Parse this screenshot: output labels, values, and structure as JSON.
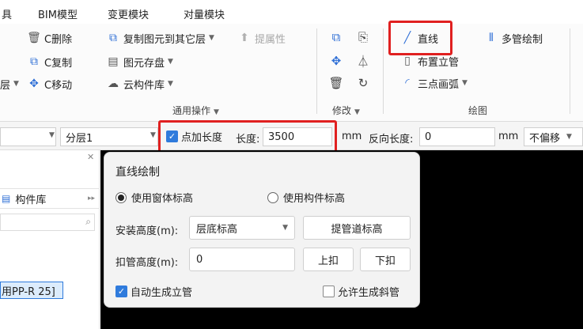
{
  "menu_tabs": [
    "具",
    "BIM模型",
    "变更模块",
    "对量模块"
  ],
  "ribbon": {
    "col1": {
      "delete": "C删除",
      "copy": "C复制",
      "layer_partial": "层",
      "move": "C移动"
    },
    "col2": {
      "copy_to_layer": "复制图元到其它层",
      "raise_attr": "提属性",
      "element_save": "图元存盘",
      "cloud_lib": "云构件库"
    },
    "group_general": "通用操作",
    "group_modify": "修改",
    "group_draw": "绘图",
    "draw": {
      "line": "直线",
      "multi_pipe": "多管绘制",
      "vertical_pipe": "布置立管",
      "three_point_arc": "三点画弧"
    }
  },
  "optionbar": {
    "layer_value": "分层1",
    "add_length_label": "点加长度",
    "length_label": "长度:",
    "length_value": "3500",
    "unit1": "mm",
    "reverse_label": "反向长度:",
    "reverse_value": "0",
    "unit2": "mm",
    "offset_value": "不偏移"
  },
  "left_panel": {
    "lib_tab": "构件库",
    "item": "用PP-R 25]"
  },
  "popup": {
    "title": "直线绘制",
    "radio_window": "使用窗体标高",
    "radio_component": "使用构件标高",
    "install_label": "安装高度(m):",
    "install_value": "层底标高",
    "pipe_elev_button": "提管道标高",
    "buckle_label": "扣管高度(m):",
    "buckle_value": "0",
    "up_button": "上扣",
    "down_button": "下扣",
    "auto_riser": "自动生成立管",
    "allow_slope": "允许生成斜管"
  },
  "colors": {
    "accent": "#2f7bdc",
    "highlight_box": "#e02020"
  }
}
